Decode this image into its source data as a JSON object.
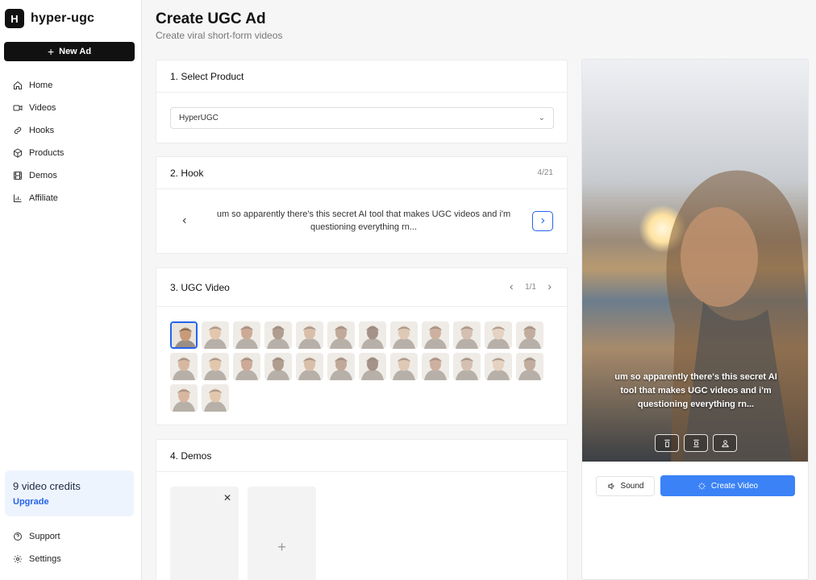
{
  "app": {
    "logo_letter": "H",
    "name": "hyper-ugc"
  },
  "sidebar": {
    "new_ad_label": "New Ad",
    "items": [
      {
        "label": "Home",
        "icon": "home-icon"
      },
      {
        "label": "Videos",
        "icon": "video-icon"
      },
      {
        "label": "Hooks",
        "icon": "link-icon"
      },
      {
        "label": "Products",
        "icon": "box-icon"
      },
      {
        "label": "Demos",
        "icon": "film-icon"
      },
      {
        "label": "Affiliate",
        "icon": "bar-chart-icon"
      }
    ],
    "credits": {
      "title": "9 video credits",
      "link": "Upgrade"
    },
    "bottom": [
      {
        "label": "Support",
        "icon": "help-circle-icon"
      },
      {
        "label": "Settings",
        "icon": "gear-icon"
      }
    ]
  },
  "header": {
    "title": "Create UGC Ad",
    "subtitle": "Create viral short-form videos"
  },
  "product": {
    "title": "1. Select Product",
    "selected": "HyperUGC"
  },
  "hook": {
    "title": "2. Hook",
    "counter": "4/21",
    "text": "um so apparently there's this secret AI tool that makes UGC videos and i'm questioning everything rn..."
  },
  "ugc": {
    "title": "3. UGC Video",
    "page": "1/1",
    "avatar_count": 26
  },
  "demos": {
    "title": "4. Demos"
  },
  "preview": {
    "caption": "um so apparently there's this secret AI tool that makes UGC videos and i'm questioning everything rn...",
    "sound_label": "Sound",
    "create_label": "Create Video"
  },
  "colors": {
    "accent": "#2563eb",
    "button_blue": "#3b82f6",
    "dark": "#111111"
  }
}
